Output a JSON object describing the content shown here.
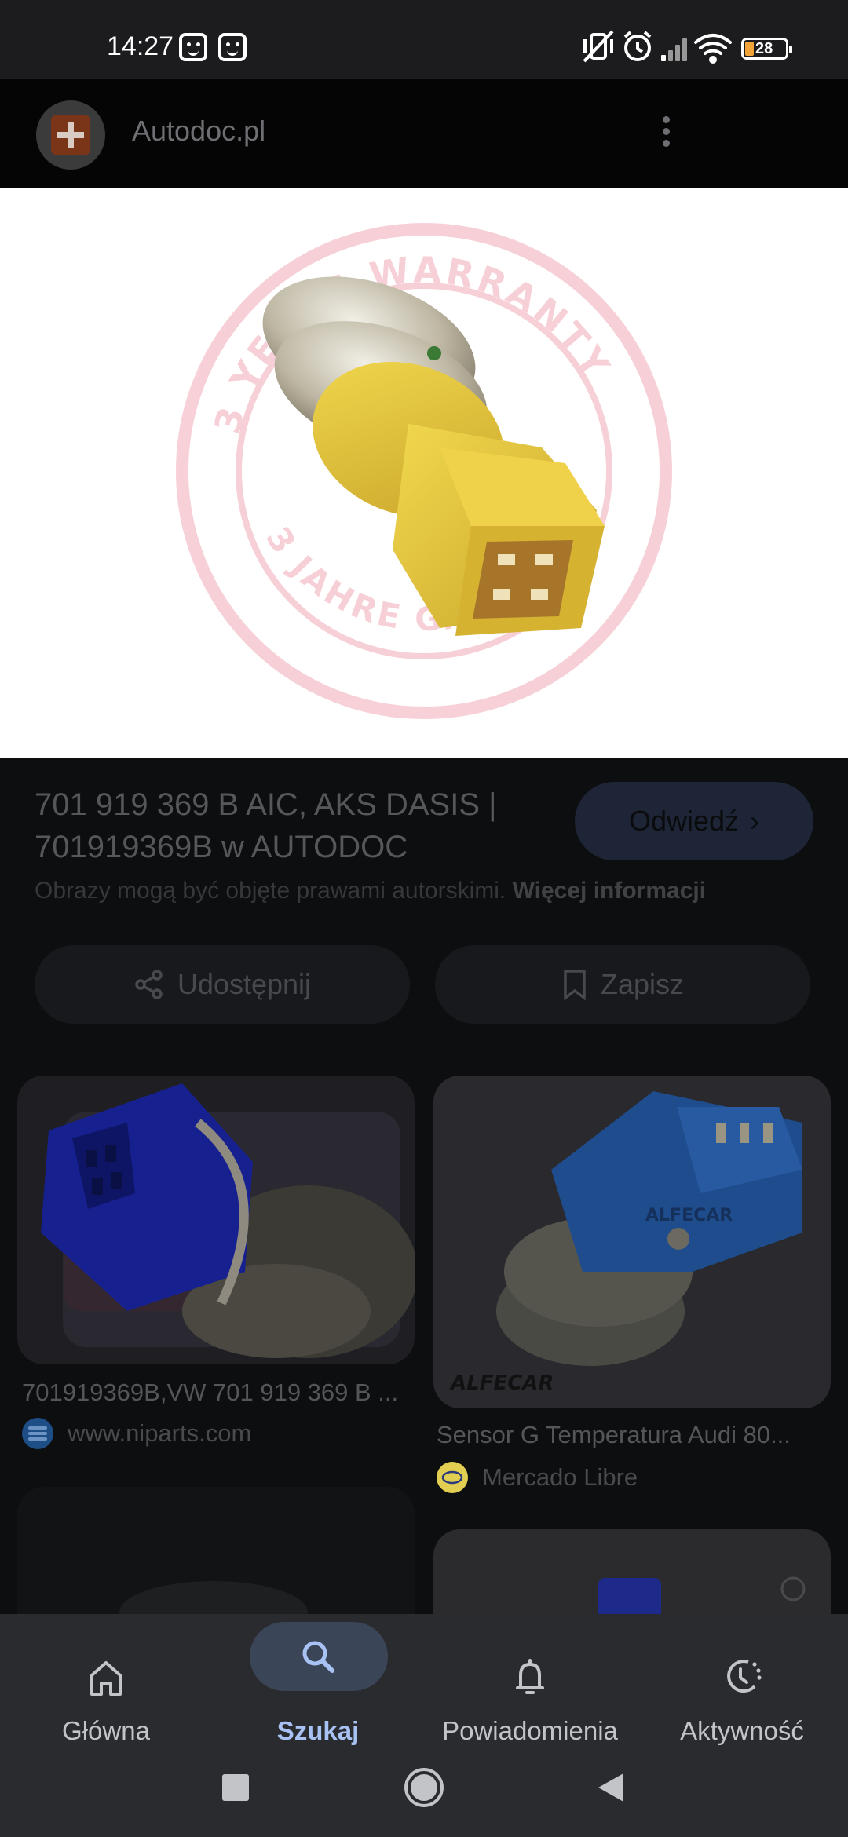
{
  "status_bar": {
    "time": "14:27",
    "battery": "28"
  },
  "app_bar": {
    "site_name": "Autodoc.pl"
  },
  "result": {
    "title": "701 919 369 B AIC, AKS DASIS | 701919369B w AUTODOC",
    "visit_label": "Odwiedź",
    "copyright_text": "Obrazy mogą być objęte prawami autorskimi.",
    "copyright_link": "Więcej informacji",
    "share_label": "Udostępnij",
    "save_label": "Zapisz"
  },
  "hero_watermark": "3 YEARS WARRANTY · 3 JAHRE GARANTIE",
  "related": [
    {
      "caption": "701919369B,VW 701 919 369 B ...",
      "source": "www.niparts.com",
      "source_color": "#1d4f86"
    },
    {
      "caption": "Sensor G Temperatura Audi 80...",
      "source": "Mercado Libre",
      "source_color": "#e2cf52",
      "brand_text": "ALFECAR"
    }
  ],
  "bottom_nav": {
    "items": [
      {
        "label": "Główna",
        "icon": "home-icon"
      },
      {
        "label": "Szukaj",
        "icon": "search-icon"
      },
      {
        "label": "Powiadomienia",
        "icon": "bell-icon"
      },
      {
        "label": "Aktywność",
        "icon": "activity-icon"
      }
    ],
    "active_index": 1
  },
  "colors": {
    "accent": "#a8c2f4",
    "nav_pill": "#3b4558",
    "sensor_yellow": "#e6c43a",
    "sensor_blue": "#2f47b8"
  }
}
